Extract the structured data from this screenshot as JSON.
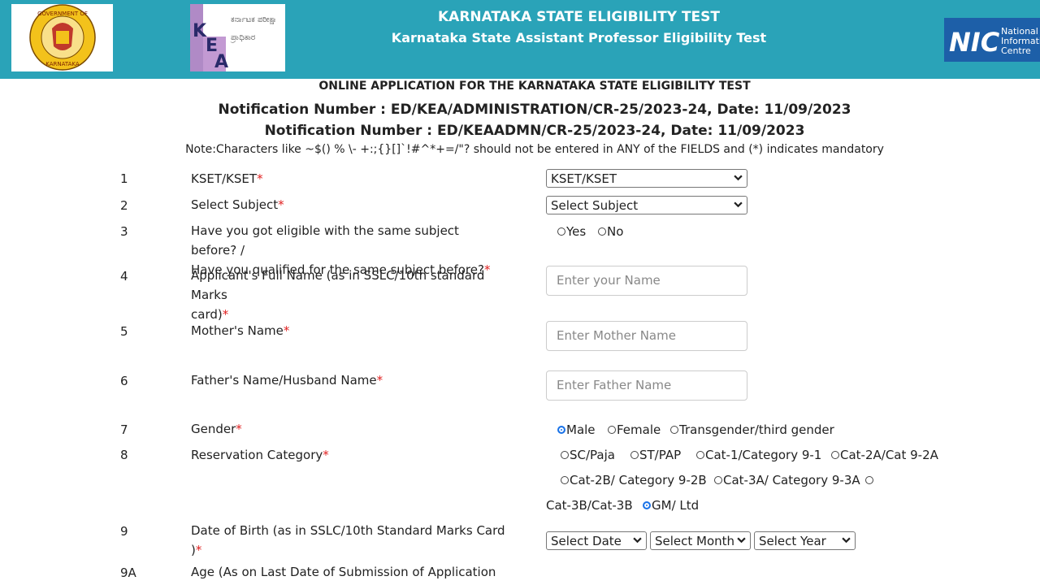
{
  "header": {
    "title1": "KARNATAKA STATE ELIGIBILITY TEST",
    "title2": "Karnataka State Assistant Professor Eligibility Test",
    "gov_logo_text_top": "GOVERNMENT OF",
    "gov_logo_text_bottom": "KARNATAKA",
    "kea_logo_letters": "KEA",
    "kea_logo_kannada": "ಕರ್ನಾಟಕ ಪರೀಕ್ಷಾ ಪ್ರಾಧಿಕಾರ",
    "nic_logo_letters": "NIC",
    "nic_logo_text": [
      "National",
      "Informatics",
      "Centre"
    ]
  },
  "intro": {
    "heading": "ONLINE APPLICATION FOR THE KARNATAKA STATE ELIGIBILITY TEST",
    "notification1": "Notification Number : ED/KEA/ADMINISTRATION/CR-25/2023-24, Date: 11/09/2023",
    "notification2": "Notification Number : ED/KEAADMN/CR-25/2023-24, Date: 11/09/2023",
    "note": "Note:Characters like ~$() % \\- +:;{}[]`!#^*+=/\"? should not be entered in ANY of the FIELDS and (*) indicates mandatory"
  },
  "form": {
    "required_mark": "*",
    "rows": [
      {
        "num": "1",
        "label": "KSET/KSET"
      },
      {
        "num": "2",
        "label": "Select Subject"
      },
      {
        "num": "3",
        "label_line1": "Have you got eligible with the same subject before? /",
        "label_line2": "Have you qualified for the same subject before?"
      },
      {
        "num": "4",
        "label_line1": "Applicant's Full Name (as in SSLC/10th standard Marks",
        "label_line2": "card)"
      },
      {
        "num": "5",
        "label": "Mother's Name"
      },
      {
        "num": "6",
        "label": "Father's Name/Husband Name"
      },
      {
        "num": "7",
        "label": "Gender"
      },
      {
        "num": "8",
        "label": "Reservation Category"
      },
      {
        "num": "9",
        "label_line1": "Date of Birth (as in SSLC/10th Standard Marks Card",
        "label_line2": ")"
      },
      {
        "num": "9A",
        "label": "Age (As on Last Date of Submission of Application"
      }
    ],
    "kset_select": "KSET/KSET",
    "subject_select": "Select Subject",
    "eligible_options": [
      "Yes",
      "No"
    ],
    "name_placeholder": "Enter your Name",
    "mother_placeholder": "Enter Mother Name",
    "father_placeholder": "Enter Father Name",
    "gender_options": [
      "Male",
      "Female",
      "Transgender/third gender"
    ],
    "gender_selected": "Male",
    "category_options": [
      "SC/Paja",
      "ST/PAP",
      "Cat-1/Category 9-1",
      "Cat-2A/Cat 9-2A",
      "Cat-2B/ Category 9-2B",
      "Cat-3A/ Category 9-3A",
      "Cat-3B/Cat-3B",
      "GM/ Ltd"
    ],
    "category_selected": "GM/ Ltd",
    "dob_date": "Select Date",
    "dob_month": "Select Month",
    "dob_year": "Select Year"
  }
}
